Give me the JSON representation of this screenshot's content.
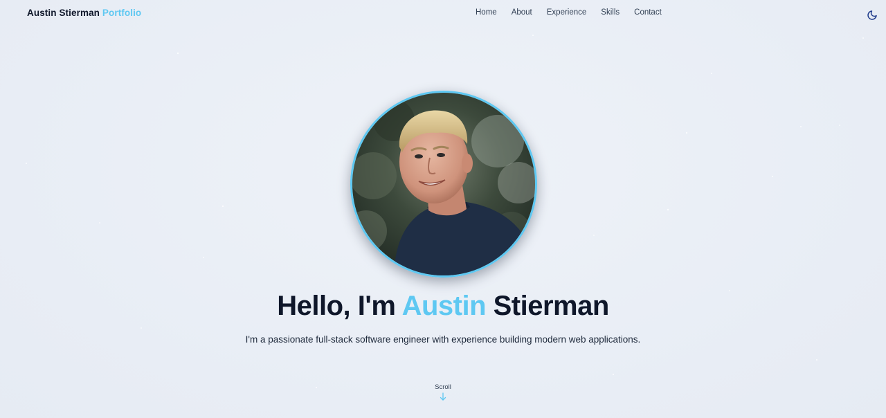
{
  "header": {
    "brand_name": "Austin Stierman",
    "brand_accent": "Portfolio",
    "nav": [
      {
        "label": "Home"
      },
      {
        "label": "About"
      },
      {
        "label": "Experience"
      },
      {
        "label": "Skills"
      },
      {
        "label": "Contact"
      }
    ],
    "theme_toggle_icon": "moon-icon"
  },
  "hero": {
    "greeting": "Hello, I'm",
    "first_name": "Austin",
    "last_name": "Stierman",
    "subtitle": "I'm a passionate full-stack software engineer with experience building modern web applications.",
    "scroll_label": "Scroll",
    "scroll_icon": "arrow-down-icon"
  },
  "colors": {
    "accent": "#5ec8f2",
    "text_dark": "#0f172a",
    "background": "#e9eef5"
  }
}
